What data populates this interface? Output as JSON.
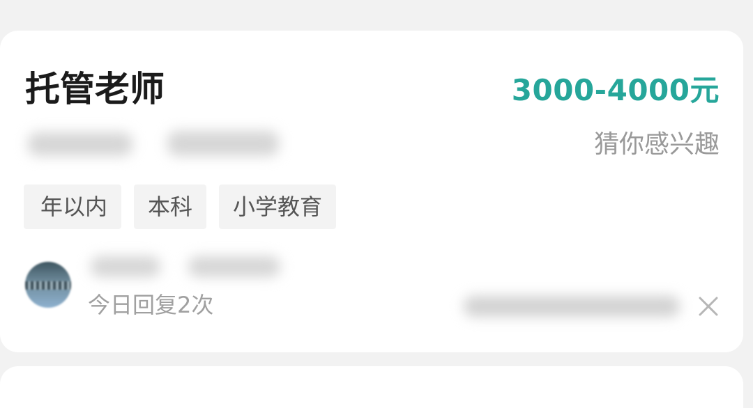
{
  "job_card": {
    "title": "托管老师",
    "salary": "3000-4000元",
    "recommend_label": "猜你感兴趣",
    "tags": [
      {
        "label": "年以内"
      },
      {
        "label": "本科"
      },
      {
        "label": "小学教育"
      }
    ],
    "reply_count": "今日回复2次",
    "close_icon": "close-icon",
    "avatar_icon": "avatar-image",
    "colors": {
      "salary": "#26a69a",
      "title": "#1b1b1b",
      "muted": "#999999",
      "tag_bg": "#f3f3f3",
      "page_bg": "#f2f2f2"
    }
  }
}
